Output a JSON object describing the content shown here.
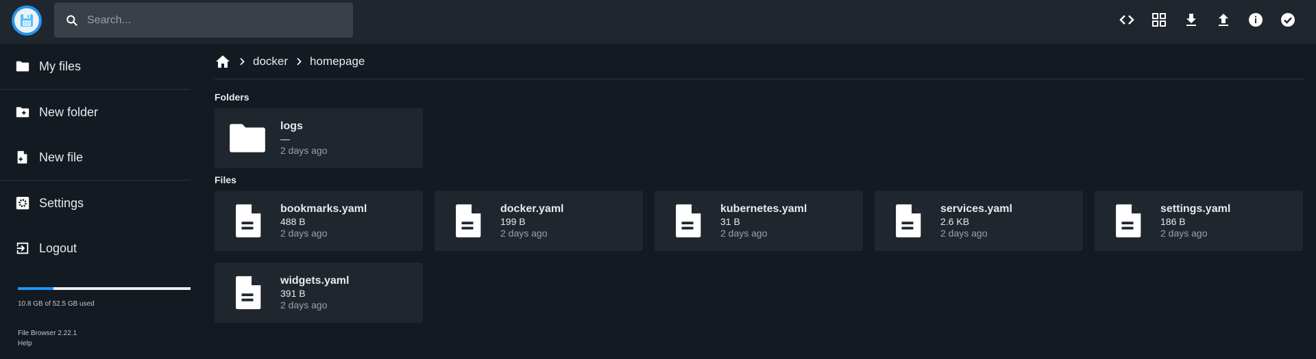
{
  "header": {
    "logo_icon": "floppy-disk-icon",
    "search": {
      "placeholder": "Search...",
      "value": ""
    },
    "actions": [
      {
        "name": "code-icon",
        "label": "Toggle shell"
      },
      {
        "name": "grid-view-icon",
        "label": "Switch view"
      },
      {
        "name": "download-icon",
        "label": "Download"
      },
      {
        "name": "upload-icon",
        "label": "Upload"
      },
      {
        "name": "info-icon",
        "label": "Info"
      },
      {
        "name": "check-circle-icon",
        "label": "Select multiple"
      }
    ]
  },
  "sidebar": {
    "items": [
      {
        "label": "My files",
        "icon": "folder-icon"
      },
      {
        "label": "New folder",
        "icon": "new-folder-icon"
      },
      {
        "label": "New file",
        "icon": "new-file-icon"
      },
      {
        "label": "Settings",
        "icon": "settings-icon"
      },
      {
        "label": "Logout",
        "icon": "logout-icon"
      }
    ],
    "usage": {
      "text": "10.8 GB of 52.5 GB used",
      "used_fraction": 0.206,
      "color": "#2196f3"
    },
    "version": "File Browser 2.22.1",
    "help": "Help"
  },
  "breadcrumbs": {
    "home_icon": "home-icon",
    "items": [
      "docker",
      "homepage"
    ]
  },
  "folders_title": "Folders",
  "files_title": "Files",
  "folders": [
    {
      "name": "logs",
      "size": "—",
      "modified": "2 days ago"
    }
  ],
  "files": [
    {
      "name": "bookmarks.yaml",
      "size": "488 B",
      "modified": "2 days ago"
    },
    {
      "name": "docker.yaml",
      "size": "199 B",
      "modified": "2 days ago"
    },
    {
      "name": "kubernetes.yaml",
      "size": "31 B",
      "modified": "2 days ago"
    },
    {
      "name": "services.yaml",
      "size": "2.6 KB",
      "modified": "2 days ago"
    },
    {
      "name": "settings.yaml",
      "size": "186 B",
      "modified": "2 days ago"
    },
    {
      "name": "widgets.yaml",
      "size": "391 B",
      "modified": "2 days ago"
    }
  ]
}
